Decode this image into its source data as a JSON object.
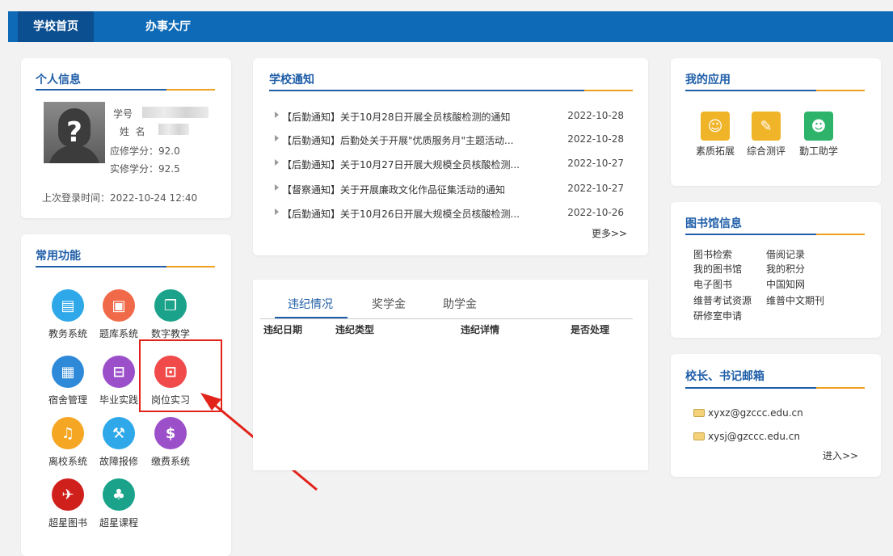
{
  "nav": {
    "tabs": [
      "学校首页",
      "办事大厅"
    ]
  },
  "personal": {
    "title": "个人信息",
    "id_label": "学号",
    "name_label": "姓  名",
    "required_credits": "应修学分：92.0",
    "earned_credits": "实修学分：92.5",
    "last_login": "上次登录时间：2022-10-24 12:40"
  },
  "functions": {
    "title": "常用功能",
    "items": [
      {
        "label": "教务系统",
        "icon": "book-icon",
        "color": "#2ea8e8"
      },
      {
        "label": "题库系统",
        "icon": "database-icon",
        "color": "#f06a4a"
      },
      {
        "label": "数字教学",
        "icon": "documents-icon",
        "color": "#1aa38a"
      },
      {
        "label": "宿舍管理",
        "icon": "building-icon",
        "color": "#2e8ad8"
      },
      {
        "label": "毕业实践",
        "icon": "car-icon",
        "color": "#9b4fc9"
      },
      {
        "label": "岗位实习",
        "icon": "briefcase-icon",
        "color": "#f04a4a"
      },
      {
        "label": "离校系统",
        "icon": "bell-icon",
        "color": "#f5a623"
      },
      {
        "label": "故障报修",
        "icon": "tools-icon",
        "color": "#2ea8e8"
      },
      {
        "label": "缴费系统",
        "icon": "payment-icon",
        "color": "#9b4fc9"
      },
      {
        "label": "超星图书",
        "icon": "chaoxing-logo-icon",
        "color": "#d0201c"
      },
      {
        "label": "超星课程",
        "icon": "people-icon",
        "color": "#1aa38a"
      }
    ]
  },
  "notices": {
    "title": "学校通知",
    "items": [
      {
        "text": "【后勤通知】关于10月28日开展全员核酸检测的通知",
        "date": "2022-10-28"
      },
      {
        "text": "【后勤通知】后勤处关于开展\"优质服务月\"主题活动...",
        "date": "2022-10-28"
      },
      {
        "text": "【后勤通知】关于10月27日开展大规模全员核酸检测...",
        "date": "2022-10-27"
      },
      {
        "text": "【督察通知】关于开展廉政文化作品征集活动的通知",
        "date": "2022-10-27"
      },
      {
        "text": "【后勤通知】关于10月26日开展大规模全员核酸检测...",
        "date": "2022-10-26"
      }
    ],
    "more": "更多>>"
  },
  "records": {
    "tabs": [
      "违纪情况",
      "奖学金",
      "助学金"
    ],
    "columns": [
      "违纪日期",
      "违纪类型",
      "违纪详情",
      "是否处理"
    ]
  },
  "apps": {
    "title": "我的应用",
    "items": [
      {
        "label": "素质拓展",
        "icon": "quality-icon",
        "color": "#f0b429"
      },
      {
        "label": "综合测评",
        "icon": "document-edit-icon",
        "color": "#f0b429"
      },
      {
        "label": "勤工助学",
        "icon": "search-person-icon",
        "color": "#2db36a"
      }
    ]
  },
  "library": {
    "title": "图书馆信息",
    "links": [
      "图书检索",
      "借阅记录",
      "我的图书馆",
      "我的积分",
      "电子图书",
      "中国知网",
      "维普考试资源",
      "维普中文期刊",
      "研修室申请"
    ]
  },
  "mailbox": {
    "title": "校长、书记邮箱",
    "emails": [
      "xyxz@gzccc.edu.cn",
      "xysj@gzccc.edu.cn"
    ],
    "enter": "进入>>"
  }
}
